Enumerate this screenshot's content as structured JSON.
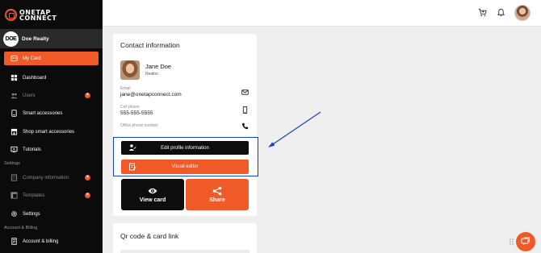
{
  "brand": {
    "line1": "ONETAP",
    "line2": "CONNECT",
    "accent": "#f05a28"
  },
  "org": {
    "avatar_text": "DOE",
    "name": "Doe Realty"
  },
  "sidebar": {
    "items": [
      {
        "label": "My Card",
        "icon": "card-icon"
      },
      {
        "label": "Dashboard",
        "icon": "dashboard-icon"
      },
      {
        "label": "Users",
        "icon": "users-icon"
      },
      {
        "label": "Smart accessories",
        "icon": "accessories-icon"
      },
      {
        "label": "Shop smart accessories",
        "icon": "shop-icon"
      },
      {
        "label": "Tutorials",
        "icon": "tutorials-icon"
      },
      {
        "label": "Company information",
        "icon": "company-icon"
      },
      {
        "label": "Templates",
        "icon": "templates-icon"
      },
      {
        "label": "Settings",
        "icon": "settings-icon"
      },
      {
        "label": "Account & billing",
        "icon": "billing-icon"
      }
    ],
    "sections": {
      "settings": "Settings",
      "account": "Account & Billing"
    }
  },
  "contact": {
    "title": "Contact information",
    "name": "Jane Doe",
    "role": "Realtor",
    "email_label": "Email",
    "email_value": "jane@onetapconnect.com",
    "cell_label": "Cell phone",
    "cell_value": "555-555-5555",
    "office_label": "Office phone number"
  },
  "buttons": {
    "edit_profile": "Edit profile information",
    "visual_editor": "Visual editor",
    "view_card": "View card",
    "share": "Share"
  },
  "qr": {
    "title": "Qr code & card link"
  },
  "colors": {
    "highlight": "#1b40d8",
    "dark_button": "#0d0d0d"
  }
}
